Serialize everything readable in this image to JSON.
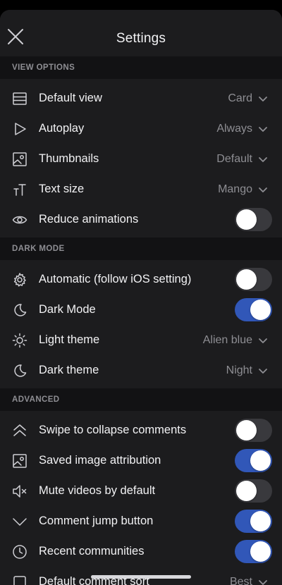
{
  "header": {
    "title": "Settings"
  },
  "sections": {
    "view_options": {
      "title": "VIEW OPTIONS",
      "rows": [
        {
          "label": "Default view",
          "value": "Card",
          "icon": "list-icon"
        },
        {
          "label": "Autoplay",
          "value": "Always",
          "icon": "play-icon"
        },
        {
          "label": "Thumbnails",
          "value": "Default",
          "icon": "image-icon"
        },
        {
          "label": "Text size",
          "value": "Mango",
          "icon": "text-size-icon"
        },
        {
          "label": "Reduce animations",
          "toggle": false,
          "icon": "eye-icon"
        }
      ]
    },
    "dark_mode": {
      "title": "DARK MODE",
      "rows": [
        {
          "label": "Automatic (follow iOS setting)",
          "toggle": false,
          "icon": "gear-icon"
        },
        {
          "label": "Dark Mode",
          "toggle": true,
          "icon": "moon-icon"
        },
        {
          "label": "Light theme",
          "value": "Alien blue",
          "icon": "sun-icon"
        },
        {
          "label": "Dark theme",
          "value": "Night",
          "icon": "moon-icon"
        }
      ]
    },
    "advanced": {
      "title": "ADVANCED",
      "rows": [
        {
          "label": "Swipe to collapse comments",
          "toggle": false,
          "icon": "double-chevron-up-icon"
        },
        {
          "label": "Saved image attribution",
          "toggle": true,
          "icon": "image-icon"
        },
        {
          "label": "Mute videos by default",
          "toggle": false,
          "icon": "speaker-mute-icon"
        },
        {
          "label": "Comment jump button",
          "toggle": true,
          "icon": "chevron-down-icon"
        },
        {
          "label": "Recent communities",
          "toggle": true,
          "icon": "clock-icon"
        },
        {
          "label": "Default comment sort",
          "value": "Best",
          "icon": "square-icon"
        }
      ]
    }
  },
  "colors": {
    "accent": "#3157b8",
    "background": "#1c1c1e",
    "section_bg": "#121214",
    "secondary_text": "#8e8e93"
  }
}
